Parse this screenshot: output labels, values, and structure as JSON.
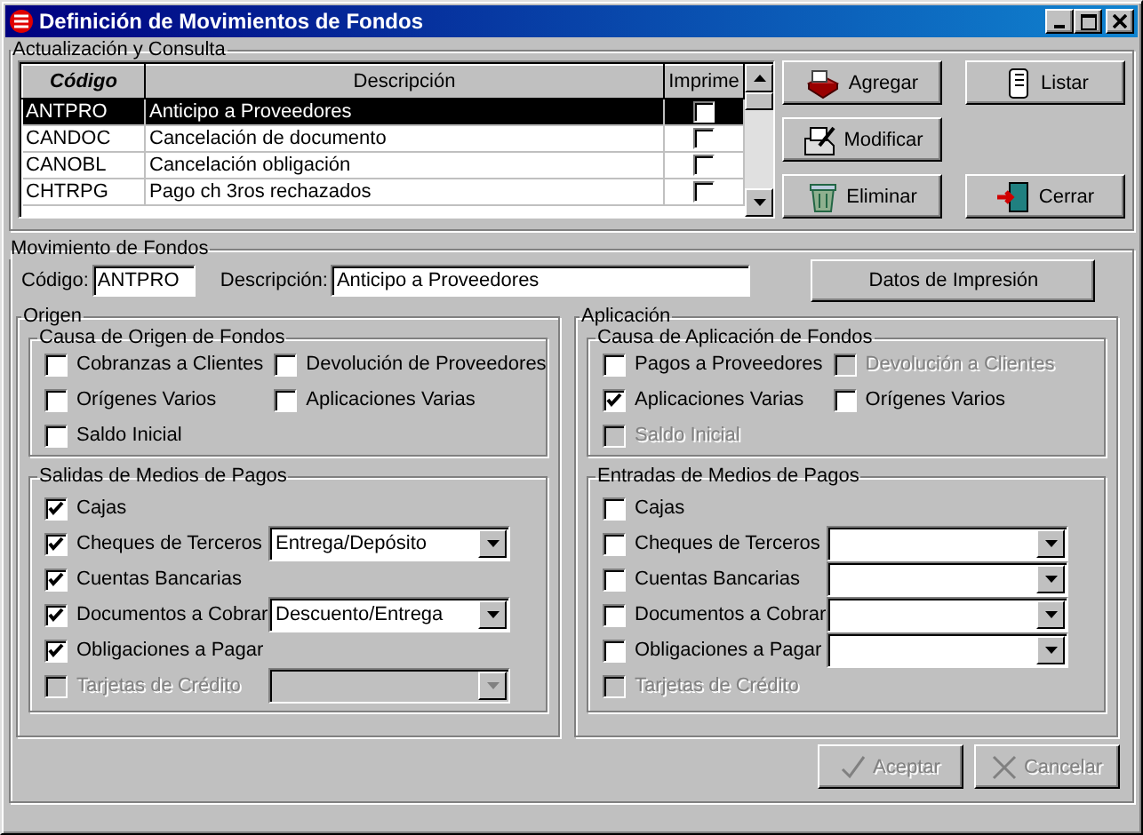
{
  "window": {
    "title": "Definición de Movimientos de Fondos"
  },
  "consulta": {
    "title": "Actualización y Consulta",
    "columns": [
      "Código",
      "Descripción",
      "Imprime"
    ],
    "rows": [
      {
        "codigo": "ANTPRO",
        "descripcion": "Anticipo a Proveedores",
        "imprime": false,
        "selected": true
      },
      {
        "codigo": "CANDOC",
        "descripcion": "Cancelación de documento",
        "imprime": false,
        "selected": false
      },
      {
        "codigo": "CANOBL",
        "descripcion": "Cancelación obligación",
        "imprime": false,
        "selected": false
      },
      {
        "codigo": "CHTRPG",
        "descripcion": "Pago ch 3ros rechazados",
        "imprime": false,
        "selected": false
      }
    ],
    "actions": [
      [
        {
          "label": "Agregar",
          "kind": "add"
        },
        {
          "label": "Listar",
          "kind": "list"
        }
      ],
      [
        {
          "label": "Modificar",
          "kind": "edit"
        }
      ],
      [
        {
          "label": "Eliminar",
          "kind": "delete"
        },
        {
          "label": "Cerrar",
          "kind": "close"
        }
      ]
    ]
  },
  "movimiento": {
    "title": "Movimiento de Fondos",
    "codigo": {
      "label": "Código:",
      "value": "ANTPRO"
    },
    "descripcion": {
      "label": "Descripción:",
      "value": "Anticipo a Proveedores"
    },
    "datos_button": "Datos de Impresión",
    "panels": [
      {
        "title": "Origen",
        "groups": [
          {
            "kind": "causa",
            "title": "Causa de Origen de Fondos",
            "items": [
              {
                "label": "Cobranzas a Clientes",
                "checked": false,
                "disabled": false
              },
              {
                "label": "Devolución de Proveedores",
                "checked": false,
                "disabled": false
              },
              {
                "label": "Orígenes Varios",
                "checked": false,
                "disabled": false
              },
              {
                "label": "Aplicaciones Varias",
                "checked": false,
                "disabled": false
              },
              {
                "label": "Saldo Inicial",
                "checked": false,
                "disabled": false
              }
            ]
          },
          {
            "kind": "medios",
            "title": "Salidas de Medios de Pagos",
            "items": [
              {
                "label": "Cajas",
                "checked": true,
                "disabled": false
              },
              {
                "label": "Cheques de Terceros",
                "checked": true,
                "disabled": false,
                "combo": {
                  "value": "Entrega/Depósito",
                  "disabled": false
                }
              },
              {
                "label": "Cuentas Bancarias",
                "checked": true,
                "disabled": false
              },
              {
                "label": "Documentos a Cobrar",
                "checked": true,
                "disabled": false,
                "combo": {
                  "value": "Descuento/Entrega",
                  "disabled": false
                }
              },
              {
                "label": "Obligaciones a Pagar",
                "checked": true,
                "disabled": false
              },
              {
                "label": "Tarjetas de Crédito",
                "checked": false,
                "disabled": true,
                "combo": {
                  "disabled": true
                }
              }
            ]
          }
        ]
      },
      {
        "title": "Aplicación",
        "groups": [
          {
            "kind": "causa",
            "title": "Causa de Aplicación de Fondos",
            "items": [
              {
                "label": "Pagos a Proveedores",
                "checked": false,
                "disabled": false
              },
              {
                "label": "Devolución a Clientes",
                "checked": false,
                "disabled": true
              },
              {
                "label": "Aplicaciones Varias",
                "checked": true,
                "disabled": false
              },
              {
                "label": "Orígenes Varios",
                "checked": false,
                "disabled": false
              },
              {
                "label": "Saldo Inicial",
                "checked": false,
                "disabled": true
              }
            ]
          },
          {
            "kind": "medios",
            "title": "Entradas de Medios de Pagos",
            "items": [
              {
                "label": "Cajas",
                "checked": false,
                "disabled": false
              },
              {
                "label": "Cheques de Terceros",
                "checked": false,
                "disabled": false,
                "combo": {
                  "disabled": false
                }
              },
              {
                "label": "Cuentas Bancarias",
                "checked": false,
                "disabled": false,
                "combo": {
                  "disabled": false
                }
              },
              {
                "label": "Documentos a Cobrar",
                "checked": false,
                "disabled": false,
                "combo": {
                  "disabled": false
                }
              },
              {
                "label": "Obligaciones a Pagar",
                "checked": false,
                "disabled": false,
                "combo": {
                  "disabled": false
                }
              },
              {
                "label": "Tarjetas de Crédito",
                "checked": false,
                "disabled": true
              }
            ]
          }
        ]
      }
    ],
    "footer_buttons": [
      {
        "label": "Aceptar",
        "kind": "ok",
        "disabled": true
      },
      {
        "label": "Cancelar",
        "kind": "cancel",
        "disabled": true
      }
    ]
  }
}
